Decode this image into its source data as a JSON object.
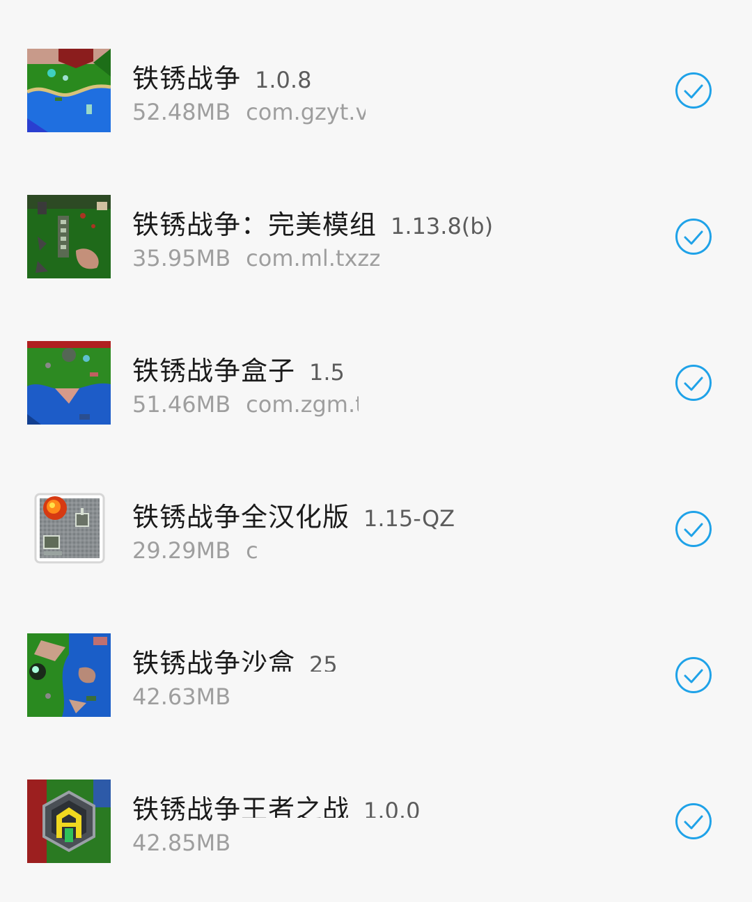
{
  "apps": [
    {
      "name": "铁锈战争",
      "version": "1.0.8",
      "size": "52.48MB",
      "package": "com.gzyt.v",
      "icon": "rusted-warfare-map-icon",
      "selected": true
    },
    {
      "name": "铁锈战争：完美模组",
      "version": "1.13.8(b)",
      "size": "35.95MB",
      "package": "com.ml.txzzwmmz",
      "icon": "rusted-warfare-units-icon",
      "selected": true
    },
    {
      "name": "铁锈战争盒子",
      "version": "1.5",
      "size": "51.46MB",
      "package": "com.zgm.tx",
      "icon": "rusted-warfare-battle-icon",
      "selected": true
    },
    {
      "name": "铁锈战争全汉化版",
      "version": "1.15-QZ",
      "size": "29.29MB",
      "package": "c",
      "icon": "explosion-tank-icon",
      "selected": true
    },
    {
      "name": "铁锈战争沙盒",
      "version": "25",
      "size": "42.63MB",
      "package": "",
      "icon": "rusted-warfare-sea-icon",
      "selected": true
    },
    {
      "name": "铁锈战争王者之战",
      "version": "1.0.0",
      "size": "42.85MB",
      "package": "",
      "icon": "hexagon-emblem-icon",
      "selected": true
    }
  ],
  "colors": {
    "background": "#f7f7f7",
    "title_text": "#1b1b1b",
    "secondary_text": "#9e9e9e",
    "check_accent": "#1fa2e8"
  }
}
